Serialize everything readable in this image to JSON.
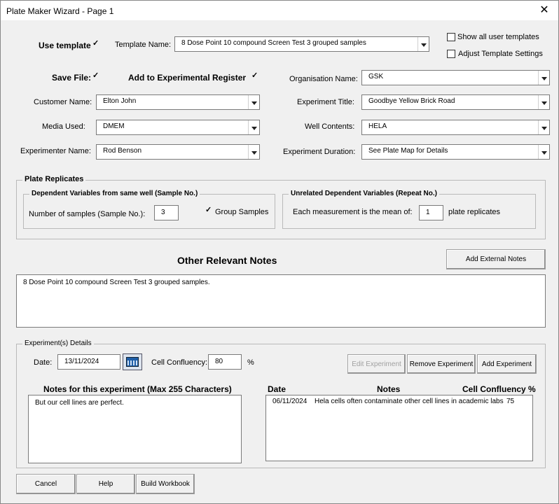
{
  "window": {
    "title": "Plate Maker Wizard - Page 1",
    "close_glyph": "✕"
  },
  "template": {
    "use_template_label": "Use template",
    "use_template_checked": true,
    "template_name_label": "Template Name:",
    "template_name_value": "8 Dose Point 10 compound Screen Test 3 grouped samples",
    "show_all_label": "Show all user templates",
    "adjust_label": "Adjust Template Settings"
  },
  "save": {
    "save_file_label": "Save File:",
    "save_file_checked": true,
    "register_label": "Add to Experimental Register",
    "register_checked": true
  },
  "fields": {
    "organisation_label": "Organisation Name:",
    "organisation_value": "GSK",
    "customer_label": "Customer Name:",
    "customer_value": "Elton John",
    "experiment_title_label": "Experiment Title:",
    "experiment_title_value": "Goodbye Yellow Brick Road",
    "media_label": "Media Used:",
    "media_value": "DMEM",
    "well_contents_label": "Well Contents:",
    "well_contents_value": "HELA",
    "experimenter_label": "Experimenter Name:",
    "experimenter_value": "Rod Benson",
    "duration_label": "Experiment Duration:",
    "duration_value": "See Plate Map for Details"
  },
  "replicates": {
    "frame_title": "Plate Replicates",
    "dependent_title": "Dependent Variables from same well (Sample No.)",
    "samples_label": "Number of samples (Sample No.):",
    "samples_value": "3",
    "group_samples_label": "Group Samples",
    "group_samples_checked": true,
    "unrelated_title": "Unrelated Dependent Variables (Repeat No.)",
    "mean_label": "Each measurement is the mean of:",
    "mean_value": "1",
    "plate_replicates_label": "plate replicates"
  },
  "notes": {
    "title": "Other Relevant Notes",
    "add_external_label": "Add External  Notes",
    "value": "8 Dose Point 10 compound Screen Test 3 grouped samples."
  },
  "experiment_details": {
    "frame_title": "Experiment(s) Details",
    "date_label": "Date:",
    "date_value": "13/11/2024",
    "confluency_label": "Cell Confluency:",
    "confluency_value": "80",
    "percent": "%",
    "edit_label": "Edit Experiment",
    "remove_label": "Remove Experiment",
    "add_label": "Add Experiment",
    "notes_title": "Notes for this experiment (Max 255 Characters)",
    "notes_value": "But our cell lines are perfect.",
    "list_headers": [
      "Date",
      "Notes",
      "Cell Confluency %"
    ],
    "list_rows": [
      {
        "date": "06/11/2024",
        "notes": "Hela cells often contaminate other cell lines in academic labs",
        "confluency": "75"
      }
    ]
  },
  "footer": {
    "cancel_label": "Cancel",
    "help_label": "Help",
    "build_label": "Build Workbook"
  }
}
